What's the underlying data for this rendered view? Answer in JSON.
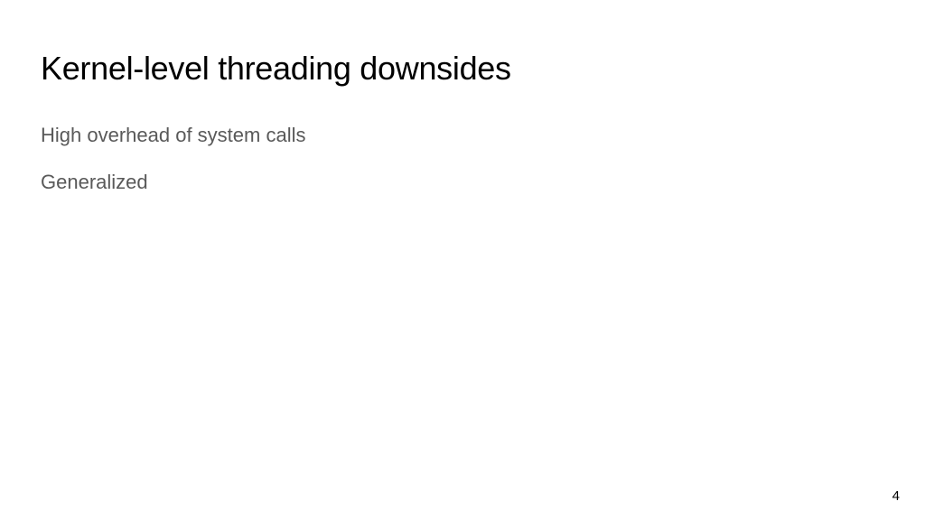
{
  "slide": {
    "title": "Kernel-level threading downsides",
    "bullets": [
      "High overhead of system calls",
      "Generalized"
    ],
    "page_number": "4"
  }
}
